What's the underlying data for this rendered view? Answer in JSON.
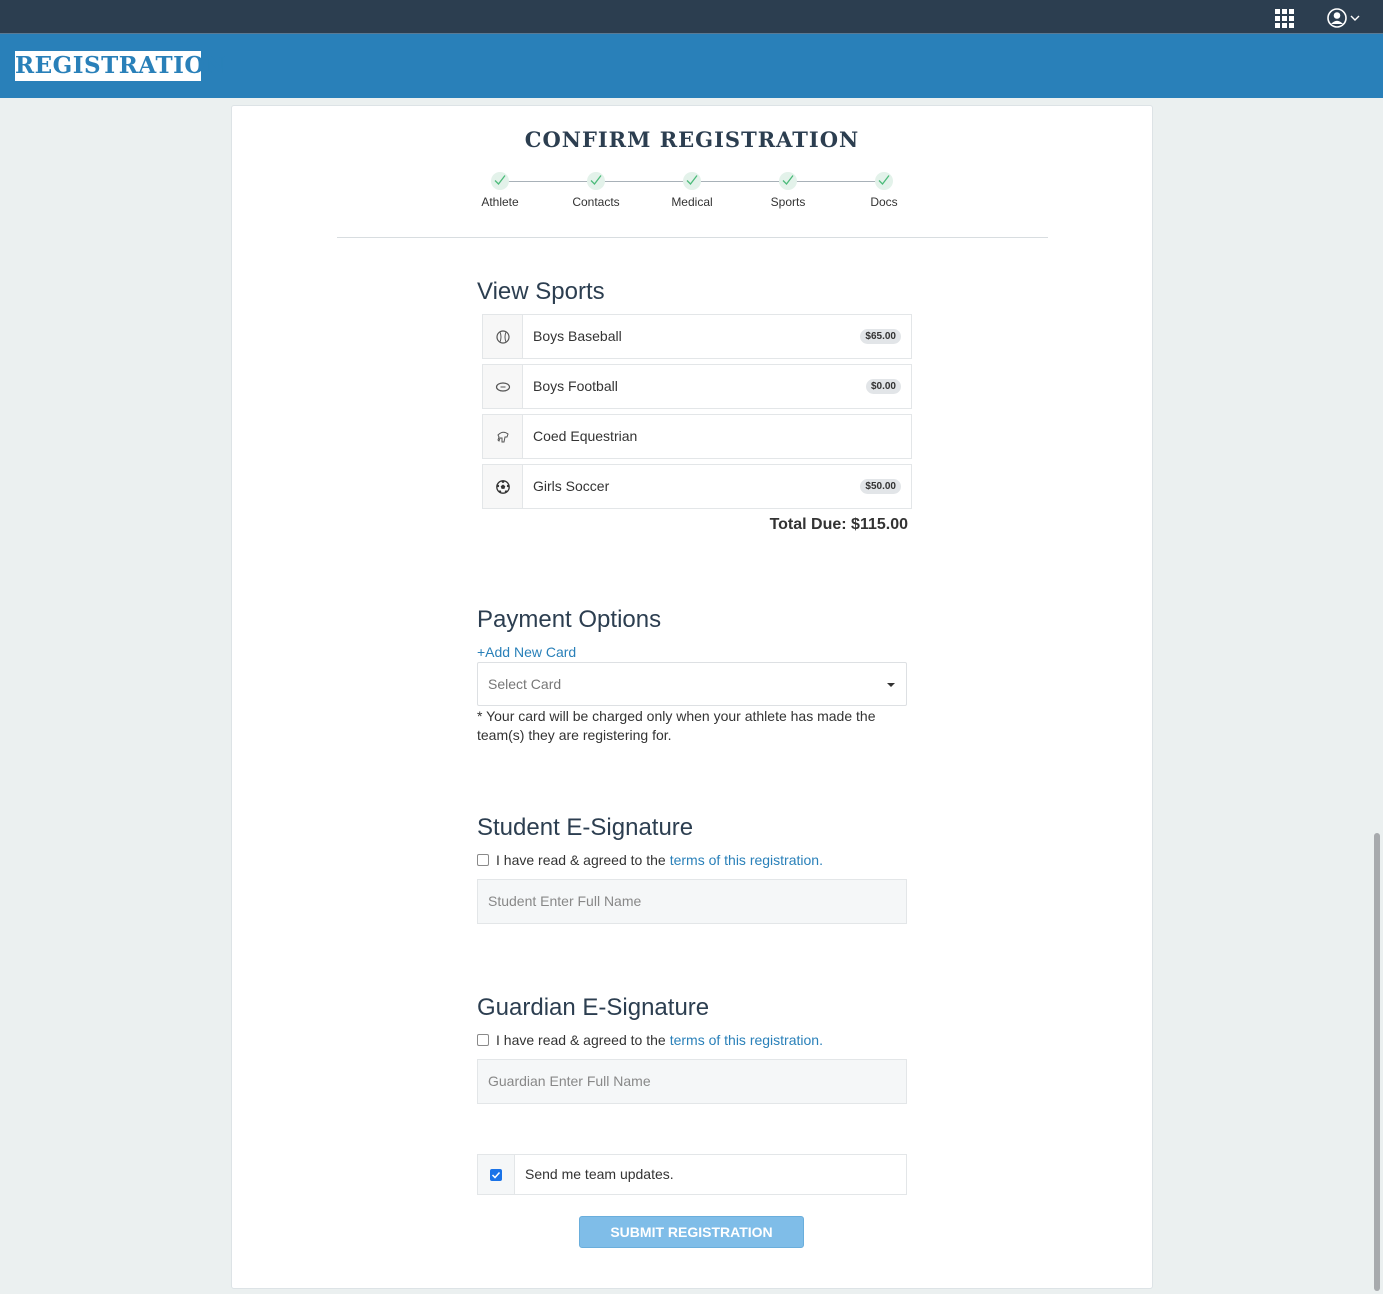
{
  "topbar": {
    "apps_icon": "grid-icon",
    "user_icon": "user-circle-icon"
  },
  "header": {
    "logo": "REGISTRATION"
  },
  "page": {
    "title": "CONFIRM REGISTRATION",
    "steps": [
      {
        "label": "Athlete",
        "complete": true
      },
      {
        "label": "Contacts",
        "complete": true
      },
      {
        "label": "Medical",
        "complete": true
      },
      {
        "label": "Sports",
        "complete": true
      },
      {
        "label": "Docs",
        "complete": true
      }
    ]
  },
  "sports": {
    "title": "View Sports",
    "items": [
      {
        "name": "Boys Baseball",
        "price": "$65.00",
        "icon": "baseball-icon"
      },
      {
        "name": "Boys Football",
        "price": "$0.00",
        "icon": "football-icon"
      },
      {
        "name": "Coed Equestrian",
        "price": "",
        "icon": "horse-icon"
      },
      {
        "name": "Girls Soccer",
        "price": "$50.00",
        "icon": "soccer-ball-icon"
      }
    ],
    "total": "Total Due: $115.00"
  },
  "payment": {
    "title": "Payment Options",
    "add_card": "+Add New Card",
    "select_placeholder": "Select Card",
    "note": "* Your card will be charged only when your athlete has made the team(s) they are registering for."
  },
  "student_signature": {
    "title": "Student E-Signature",
    "agree_text": "I have read & agreed to the",
    "terms_link": "terms of this registration.",
    "checked": false,
    "placeholder": "Student Enter Full Name"
  },
  "guardian_signature": {
    "title": "Guardian E-Signature",
    "agree_text": "I have read & agreed to the",
    "terms_link": "terms of this registration.",
    "checked": false,
    "placeholder": "Guardian Enter Full Name"
  },
  "updates": {
    "label": "Send me team updates.",
    "checked": true
  },
  "submit_label": "SUBMIT REGISTRATION"
}
